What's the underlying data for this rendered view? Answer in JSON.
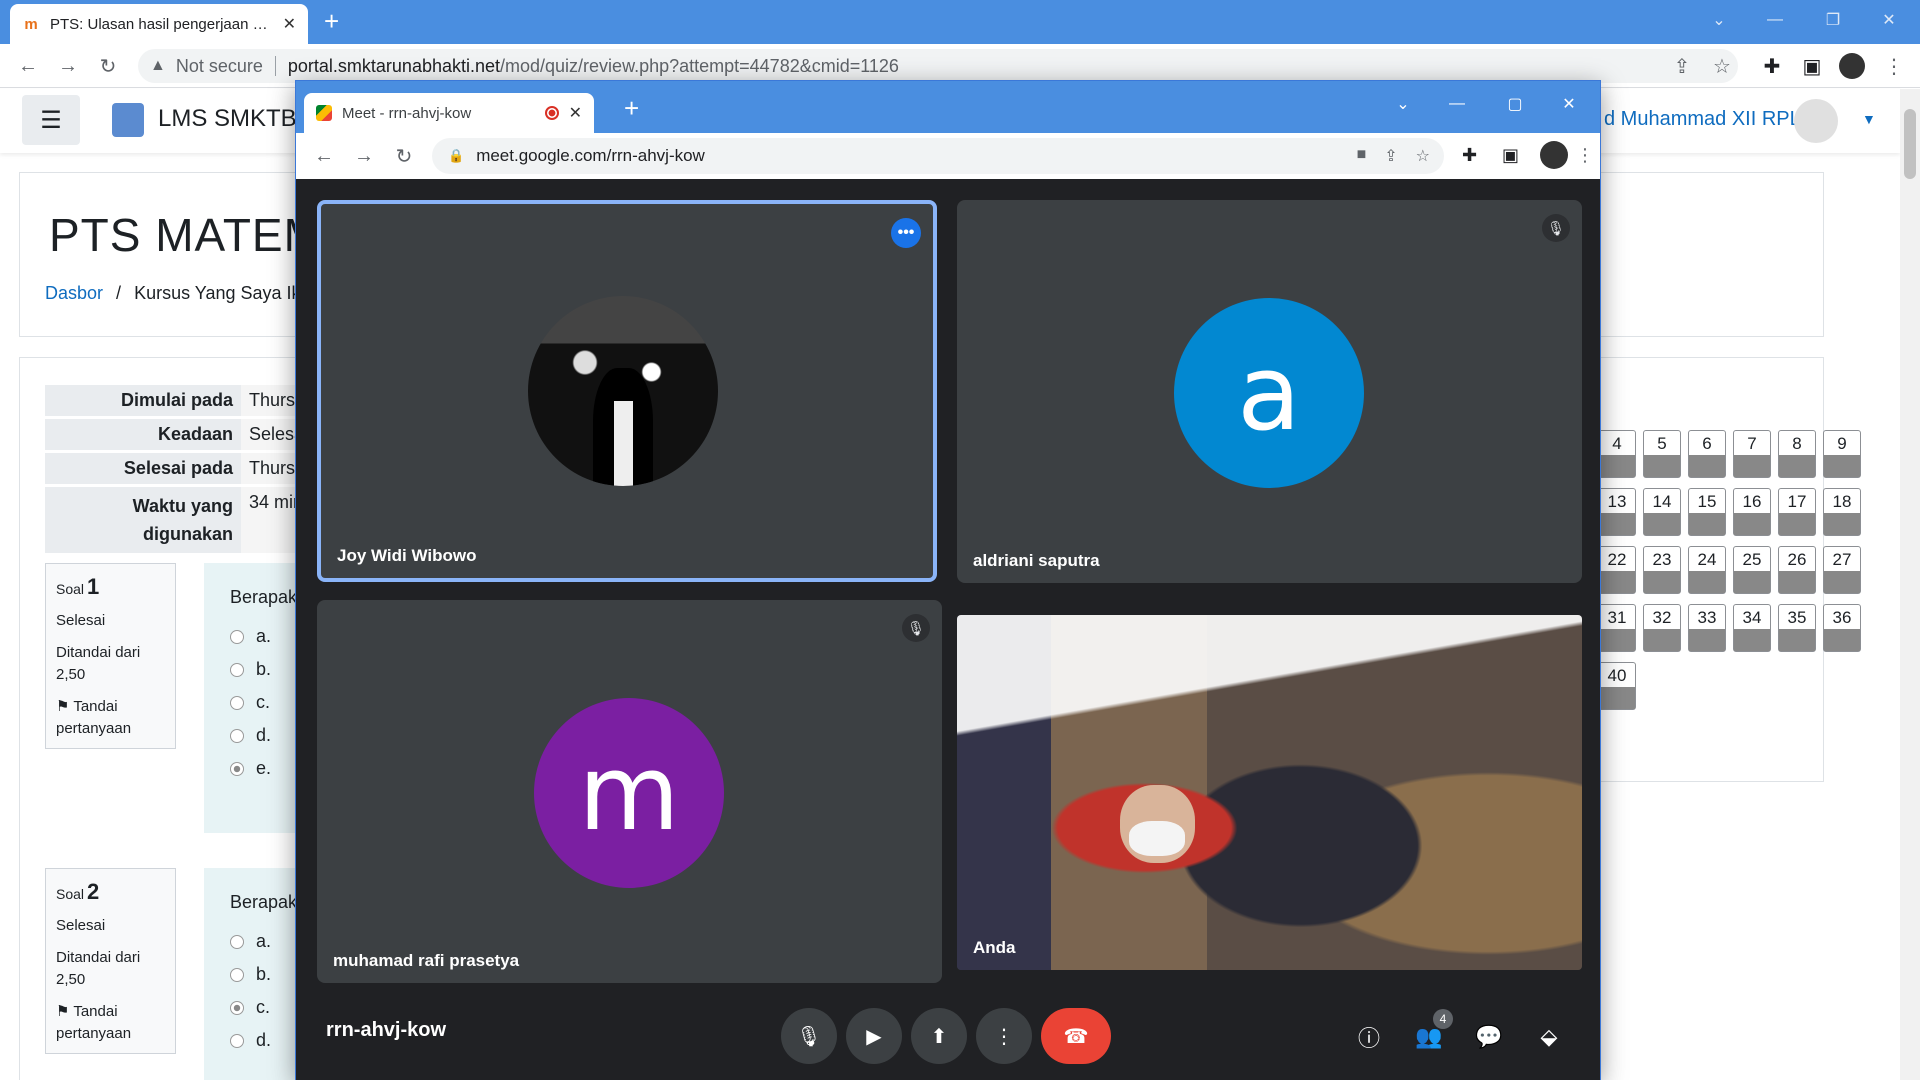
{
  "back_browser": {
    "tab_title": "PTS: Ulasan hasil pengerjaan kuis",
    "favicon_letter": "m",
    "omnibox": {
      "security": "Not secure",
      "host": "portal.smktarunabhakti.net",
      "path": "/mod/quiz/review.php?attempt=44782&cmid=1126"
    }
  },
  "lms": {
    "brand": "LMS SMKTB",
    "user": "d Muhammad XII RPL 2",
    "page_title": "PTS MATEM",
    "breadcrumb": {
      "home": "Dasbor",
      "sep": "/",
      "current": "Kursus Yang Saya Ik"
    },
    "summary": [
      {
        "key": "Dimulai pada",
        "value": "Thursc"
      },
      {
        "key": "Keadaan",
        "value": "Selesa"
      },
      {
        "key": "Selesai pada",
        "value": "Thursc"
      },
      {
        "key": "Waktu yang digunakan",
        "value": "34 mir"
      }
    ],
    "questions": [
      {
        "label": "Soal",
        "number": "1",
        "state": "Selesai",
        "marks": "Ditandai dari 2,50",
        "flag": "Tandai pertanyaan",
        "text": "Berapak",
        "options": [
          "a.",
          "b.",
          "c.",
          "d.",
          "e."
        ],
        "selected": 4
      },
      {
        "label": "Soal",
        "number": "2",
        "state": "Selesai",
        "marks": "Ditandai dari 2,50",
        "flag": "Tandai pertanyaan",
        "text": "Berapak",
        "options": [
          "a.",
          "b.",
          "c.",
          "d."
        ],
        "selected": 2
      }
    ],
    "quiz_nav": [
      "4",
      "5",
      "6",
      "7",
      "8",
      "9",
      "13",
      "14",
      "15",
      "16",
      "17",
      "18",
      "22",
      "23",
      "24",
      "25",
      "26",
      "27",
      "31",
      "32",
      "33",
      "34",
      "35",
      "36",
      "40"
    ]
  },
  "meet": {
    "tab_title": "Meet - rrn-ahvj-kow",
    "url": "meet.google.com/rrn-ahvj-kow",
    "participants": [
      {
        "name": "Joy Widi Wibowo",
        "kind": "photo"
      },
      {
        "name": "aldriani saputra",
        "initial": "a",
        "color": "#0288d1"
      },
      {
        "name": "muhamad rafi prasetya",
        "initial": "m",
        "color": "#7b1fa2"
      },
      {
        "name": "Anda",
        "kind": "camera"
      }
    ],
    "meeting_code": "rrn-ahvj-kow",
    "people_count": "4"
  }
}
